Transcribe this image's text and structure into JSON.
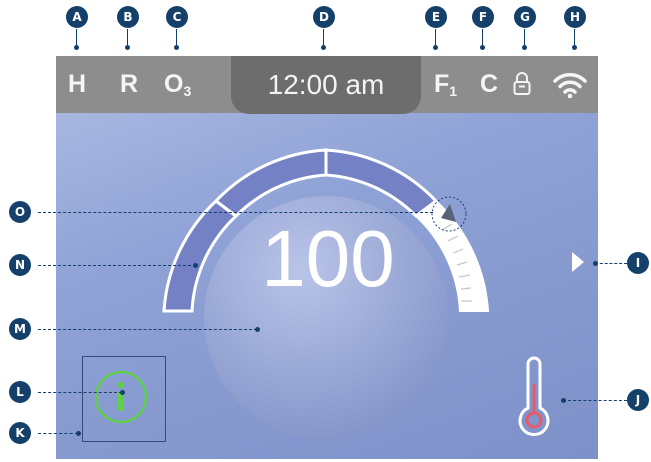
{
  "callouts": {
    "a": "A",
    "b": "B",
    "c": "C",
    "d": "D",
    "e": "E",
    "f": "F",
    "g": "G",
    "h": "H",
    "i": "I",
    "j": "J",
    "k": "K",
    "l": "L",
    "m": "M",
    "n": "N",
    "o": "O"
  },
  "status_bar": {
    "heater": "H",
    "reservation": "R",
    "ozone": "O",
    "ozone_sub": "3",
    "clock": "12:00 am",
    "filter": "F",
    "filter_sub": "1",
    "units": "C",
    "lock_icon": "lock-icon",
    "wifi_icon": "wifi-icon"
  },
  "gauge": {
    "setpoint": "100",
    "segments_filled": 3,
    "segments_total": 4
  },
  "icons": {
    "info": "info-icon",
    "next": "play-arrow-icon",
    "temperature": "thermometer-icon"
  },
  "colors": {
    "callout": "#15406a",
    "screen_bg": "#8fa2d6",
    "status_bar": "#8d8d8d",
    "info_green": "#5fd04a",
    "thermo_red": "#e85a6a"
  }
}
